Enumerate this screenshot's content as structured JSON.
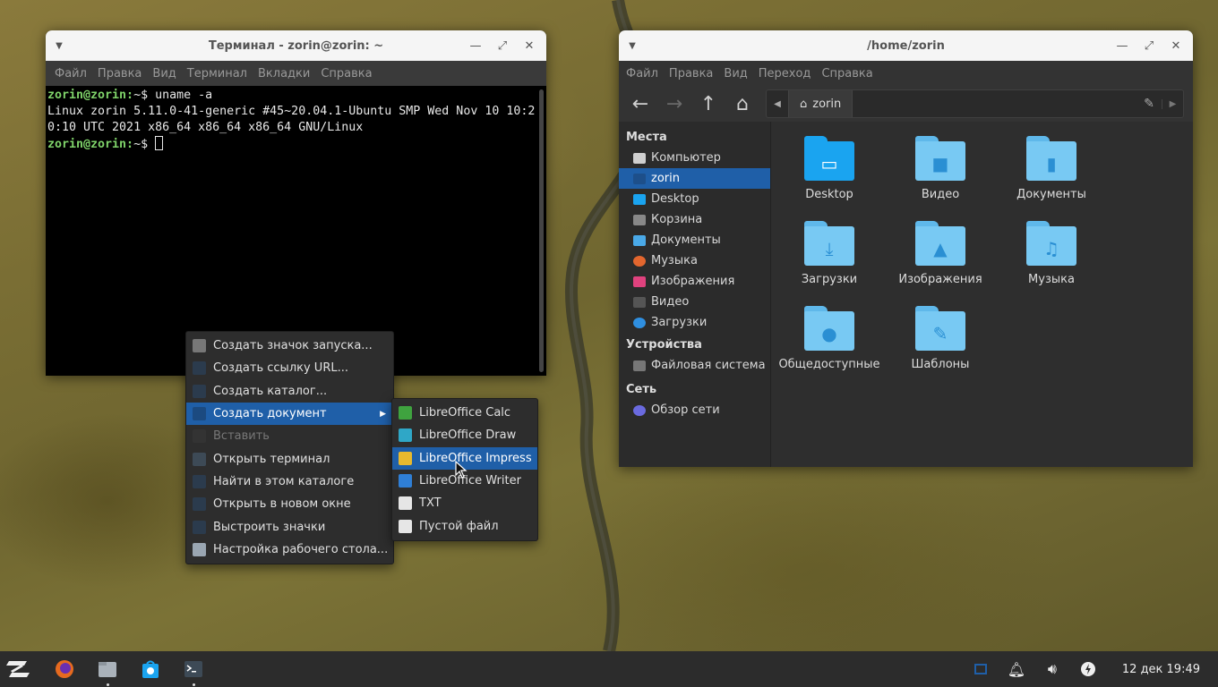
{
  "terminal": {
    "title": "Терминал - zorin@zorin: ~",
    "menu": [
      "Файл",
      "Правка",
      "Вид",
      "Терминал",
      "Вкладки",
      "Справка"
    ],
    "lines": [
      {
        "prompt": "zorin@zorin:",
        "suffix": "~$ ",
        "cmd": "uname -a"
      },
      {
        "output": "Linux zorin 5.11.0-41-generic #45~20.04.1-Ubuntu SMP Wed Nov 10 10:20:10 UTC 2021 x86_64 x86_64 x86_64 GNU/Linux"
      },
      {
        "prompt": "zorin@zorin:",
        "suffix": "~$ ",
        "cmd": ""
      }
    ]
  },
  "files": {
    "title": "/home/zorin",
    "menu": [
      "Файл",
      "Правка",
      "Вид",
      "Переход",
      "Справка"
    ],
    "path_crumb": "zorin",
    "sidebar": {
      "places_label": "Места",
      "places": [
        "Компьютер",
        "zorin",
        "Desktop",
        "Корзина",
        "Документы",
        "Музыка",
        "Изображения",
        "Видео",
        "Загрузки"
      ],
      "devices_label": "Устройства",
      "devices": [
        "Файловая система"
      ],
      "network_label": "Сеть",
      "network": [
        "Обзор сети"
      ]
    },
    "items": [
      "Desktop",
      "Видео",
      "Документы",
      "Загрузки",
      "Изображения",
      "Музыка",
      "Общедоступные",
      "Шаблоны"
    ]
  },
  "desktop_menu": {
    "items": [
      "Создать значок запуска...",
      "Создать ссылку URL...",
      "Создать каталог...",
      "Создать документ",
      "Вставить",
      "Открыть терминал",
      "Найти в этом каталоге",
      "Открыть в новом окне",
      "Выстроить значки",
      "Настройка рабочего стола..."
    ]
  },
  "submenu": {
    "items": [
      "LibreOffice Calc",
      "LibreOffice Draw",
      "LibreOffice Impress",
      "LibreOffice Writer",
      "TXT",
      "Пустой файл"
    ]
  },
  "taskbar": {
    "clock": "12 дек 19:49"
  },
  "colors": {
    "selection": "#1f5fa8",
    "folder": "#78c9f3",
    "prompt": "#7fd36a"
  }
}
